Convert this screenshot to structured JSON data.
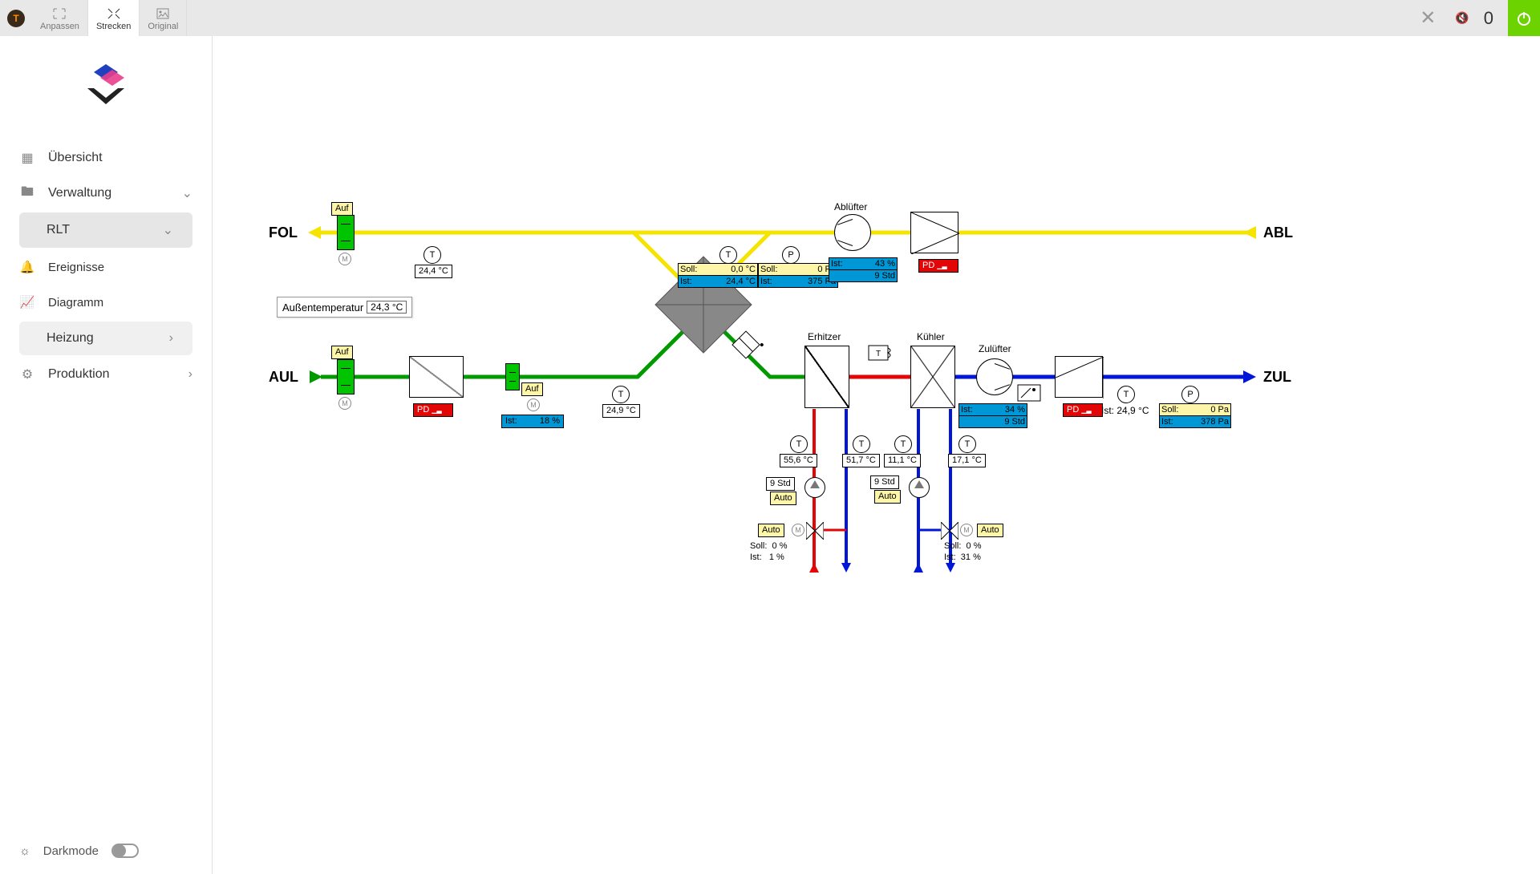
{
  "toolbar": {
    "anpassen": "Anpassen",
    "strecken": "Strecken",
    "original": "Original",
    "counter": "0"
  },
  "sidebar": {
    "items": [
      {
        "label": "Übersicht"
      },
      {
        "label": "Verwaltung"
      },
      {
        "label": "RLT"
      },
      {
        "label": "Ereignisse"
      },
      {
        "label": "Diagramm"
      },
      {
        "label": "Heizung"
      },
      {
        "label": "Produktion"
      }
    ],
    "darkmode": "Darkmode"
  },
  "diagram": {
    "endpoints": {
      "fol": "FOL",
      "abl": "ABL",
      "aul": "AUL",
      "zul": "ZUL"
    },
    "damper_auf1": "Auf",
    "damper_auf2": "Auf",
    "bypass_auf": "Auf",
    "outside_temp_label": "Außentemperatur",
    "outside_temp_value": "24,3 °C",
    "fol_temp": "24,4  °C",
    "abl_temp_soll_label": "Soll:",
    "abl_temp_soll_value": "0,0 °C",
    "abl_temp_ist_label": "Ist:",
    "abl_temp_ist_value": "24,4 °C",
    "abl_p_soll_label": "Soll:",
    "abl_p_soll_value": "0  Pa",
    "abl_p_ist_label": "Ist:",
    "abl_p_ist_value": "375  Pa",
    "abl_fan_label": "Ablüfter",
    "abl_fan_ist_label": "Ist:",
    "abl_fan_pct": "43  %",
    "abl_fan_time": "9  Std",
    "aul_pd": "PD",
    "abl_pd": "PD",
    "zul_pd": "PD",
    "bypass_ist_label": "Ist:",
    "bypass_ist_value": "18  %",
    "aul_mix_temp": "24,9  °C",
    "erhitzer_label": "Erhitzer",
    "kuehler_label": "Kühler",
    "zul_fan_label": "Zulüfter",
    "heater_supply_t": "55,6  °C",
    "heater_return_t": "51,7  °C",
    "cooler_supply_t": "11,1  °C",
    "cooler_return_t": "17,1  °C",
    "heater_pump_time": "9  Std",
    "heater_pump_auto": "Auto",
    "cooler_pump_time": "9  Std",
    "cooler_pump_auto": "Auto",
    "heater_valve_auto": "Auto",
    "cooler_valve_auto": "Auto",
    "heater_soll_label": "Soll:",
    "heater_soll_value": "0  %",
    "heater_ist_label": "Ist:",
    "heater_ist_value": "1  %",
    "cooler_soll_label": "Soll:",
    "cooler_soll_value": "0  %",
    "cooler_ist_label": "Ist:",
    "cooler_ist_value": "31  %",
    "zul_fan_ist_label": "Ist:",
    "zul_fan_pct": "34  %",
    "zul_fan_time": "9  Std",
    "zul_temp_label": "Ist:",
    "zul_temp_value": "24,9  °C",
    "zul_p_soll_label": "Soll:",
    "zul_p_soll_value": "0  Pa",
    "zul_p_ist_label": "Ist:",
    "zul_p_ist_value": "378  Pa"
  }
}
